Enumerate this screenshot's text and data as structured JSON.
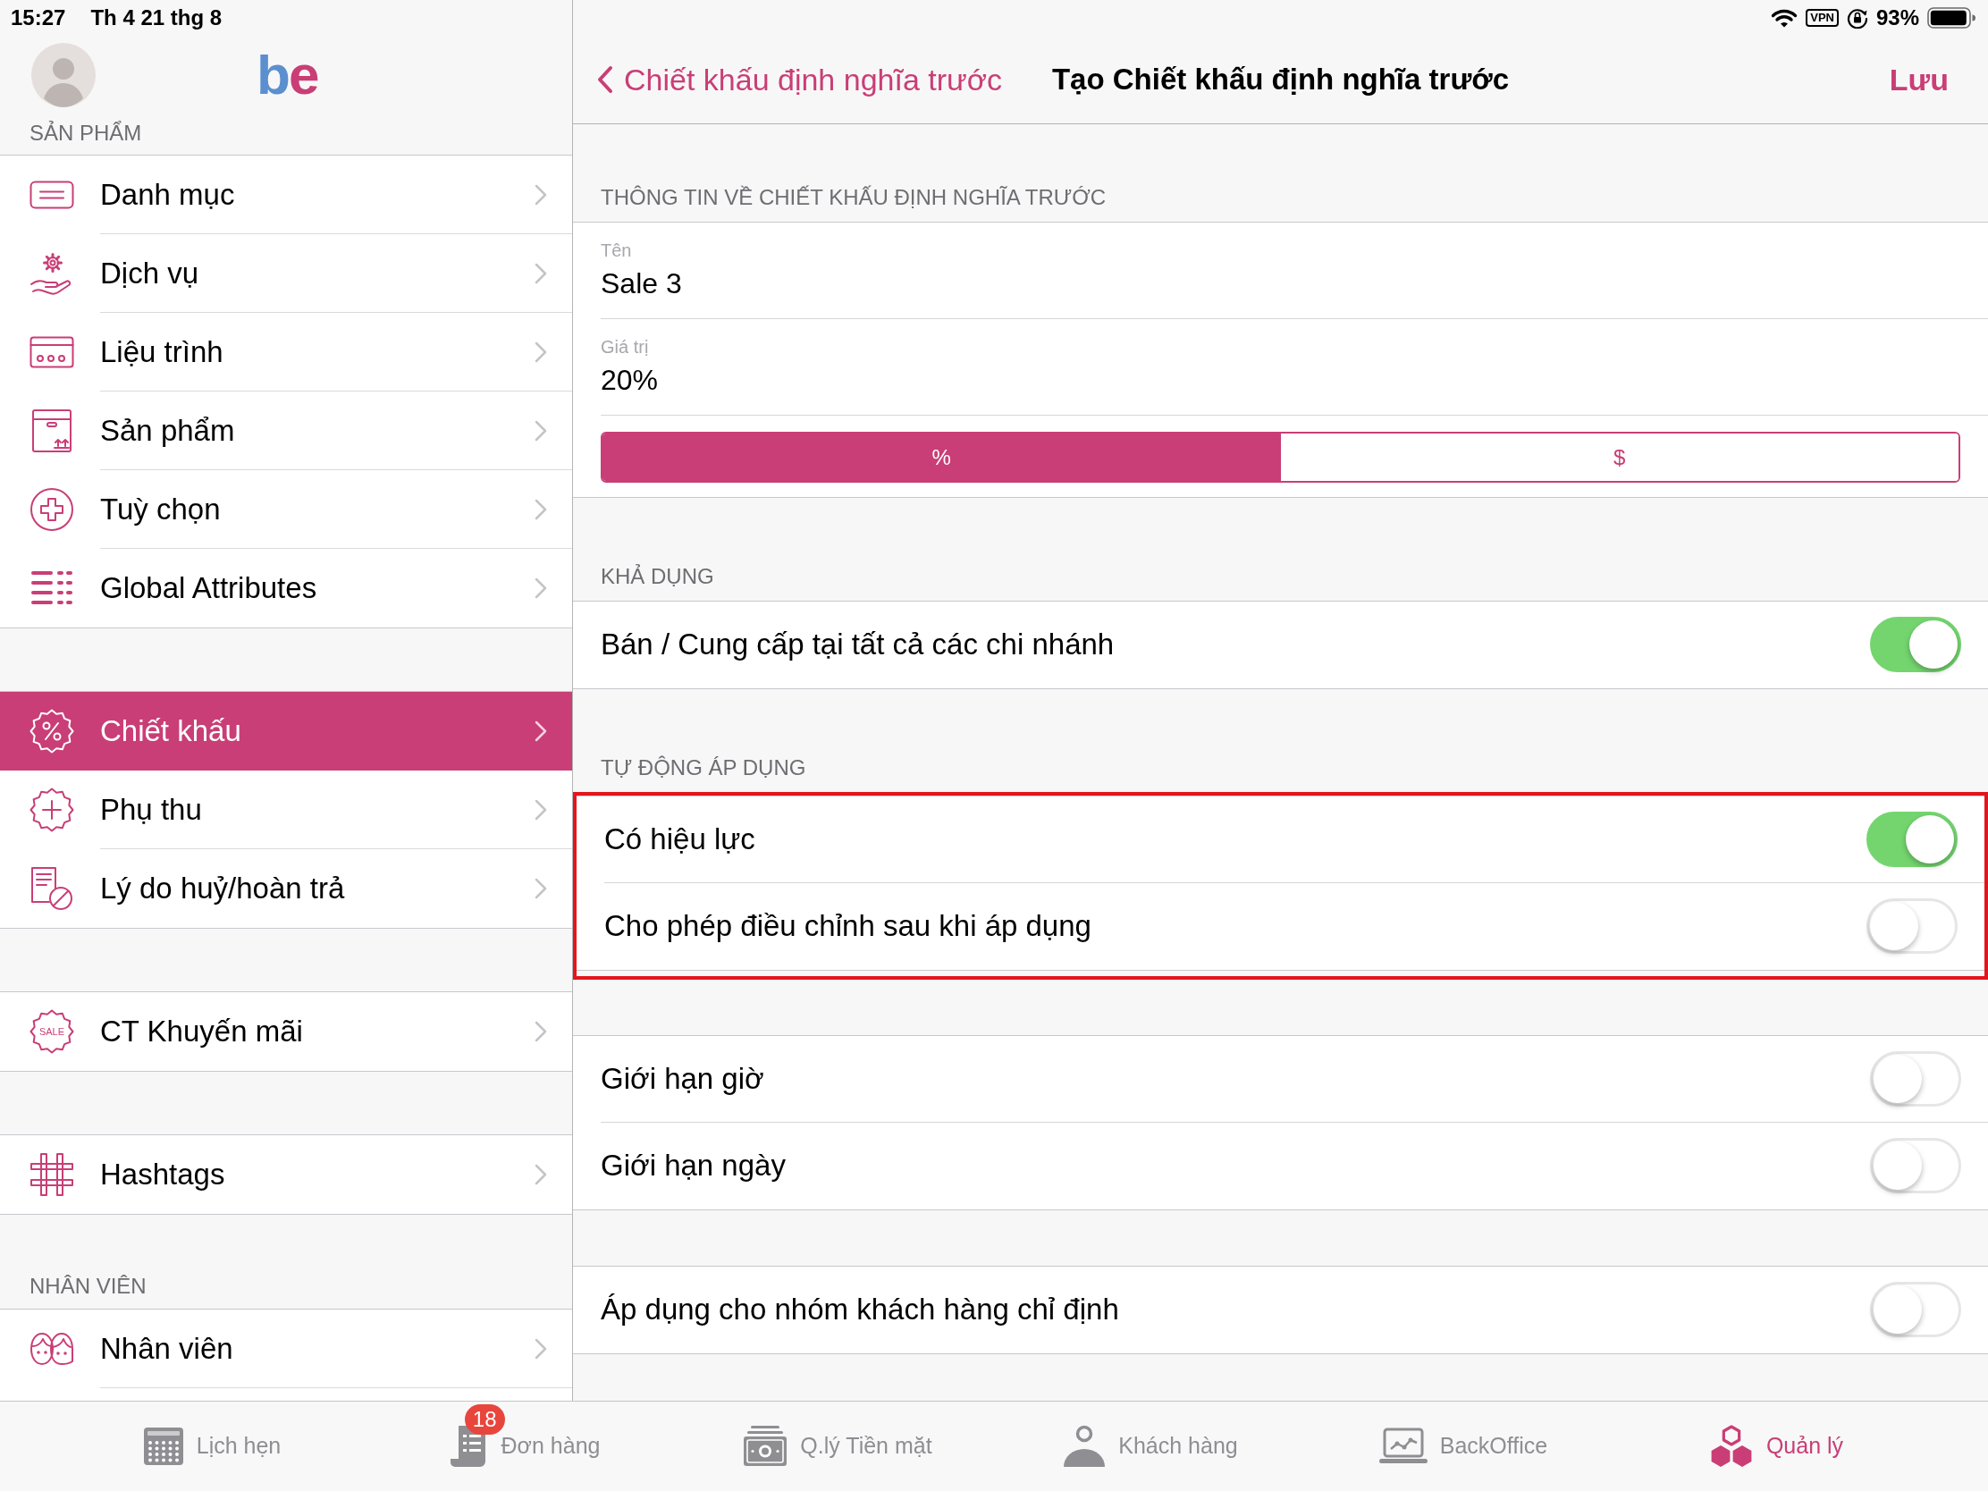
{
  "status_bar": {
    "time": "15:27",
    "date": "Th 4 21 thg 8",
    "vpn": "VPN",
    "battery": "93%"
  },
  "sidebar": {
    "logo": [
      {
        "text": "b",
        "color": "#5b8fcf"
      },
      {
        "text": "e",
        "color": "#c93e76"
      }
    ],
    "groups": [
      {
        "header": "SẢN PHẨM",
        "items": [
          {
            "label": "Danh mục",
            "selected": false
          },
          {
            "label": "Dịch vụ",
            "selected": false
          },
          {
            "label": "Liệu trình",
            "selected": false
          },
          {
            "label": "Sản phẩm",
            "selected": false
          },
          {
            "label": "Tuỳ chọn",
            "selected": false
          },
          {
            "label": "Global Attributes",
            "selected": false
          }
        ]
      },
      {
        "items": [
          {
            "label": "Chiết khấu",
            "selected": true
          },
          {
            "label": "Phụ thu",
            "selected": false
          },
          {
            "label": "Lý do huỷ/hoàn trả",
            "selected": false
          }
        ]
      },
      {
        "items": [
          {
            "label": "CT Khuyến mãi",
            "icon_text": "SALE",
            "selected": false
          }
        ]
      },
      {
        "items": [
          {
            "label": "Hashtags",
            "selected": false
          }
        ]
      },
      {
        "header": "NHÂN VIÊN",
        "items": [
          {
            "label": "Nhân viên",
            "selected": false
          }
        ]
      }
    ]
  },
  "nav_bar": {
    "back": "Chiết khấu định nghĩa trước",
    "title": "Tạo Chiết khấu định nghĩa trước",
    "action": "Lưu"
  },
  "sections": [
    {
      "header": "THÔNG TIN VỀ CHIẾT KHẤU ĐỊNH NGHĨA TRƯỚC",
      "rows": [
        {
          "kind": "field",
          "label": "Tên",
          "value": "Sale 3"
        },
        {
          "kind": "field",
          "label": "Giá trị",
          "value": "20%"
        },
        {
          "kind": "segmented",
          "segments": [
            {
              "label": "%",
              "selected": true
            },
            {
              "label": "$",
              "selected": false
            }
          ]
        }
      ]
    },
    {
      "header": "KHẢ DỤNG",
      "rows": [
        {
          "kind": "switch",
          "label": "Bán / Cung cấp tại tất cả các chi nhánh",
          "on": true
        }
      ]
    },
    {
      "header": "TỰ ĐỘNG ÁP DỤNG",
      "highlighted": true,
      "rows": [
        {
          "kind": "switch",
          "label": "Có hiệu lực",
          "on": true
        },
        {
          "kind": "switch",
          "label": "Cho phép điều chỉnh sau khi áp dụng",
          "on": false
        }
      ]
    },
    {
      "rows": [
        {
          "kind": "switch",
          "label": "Giới hạn giờ",
          "on": false
        },
        {
          "kind": "switch",
          "label": "Giới hạn ngày",
          "on": false
        }
      ]
    },
    {
      "rows": [
        {
          "kind": "switch",
          "label": "Áp dụng cho nhóm khách hàng chỉ định",
          "on": false
        }
      ]
    }
  ],
  "tab_bar": [
    {
      "label": "Lịch hẹn",
      "selected": false
    },
    {
      "label": "Đơn hàng",
      "badge": "18",
      "selected": false
    },
    {
      "label": "Q.lý Tiền mặt",
      "selected": false
    },
    {
      "label": "Khách hàng",
      "selected": false
    },
    {
      "label": "BackOffice",
      "selected": false
    },
    {
      "label": "Quản lý",
      "selected": true
    }
  ]
}
